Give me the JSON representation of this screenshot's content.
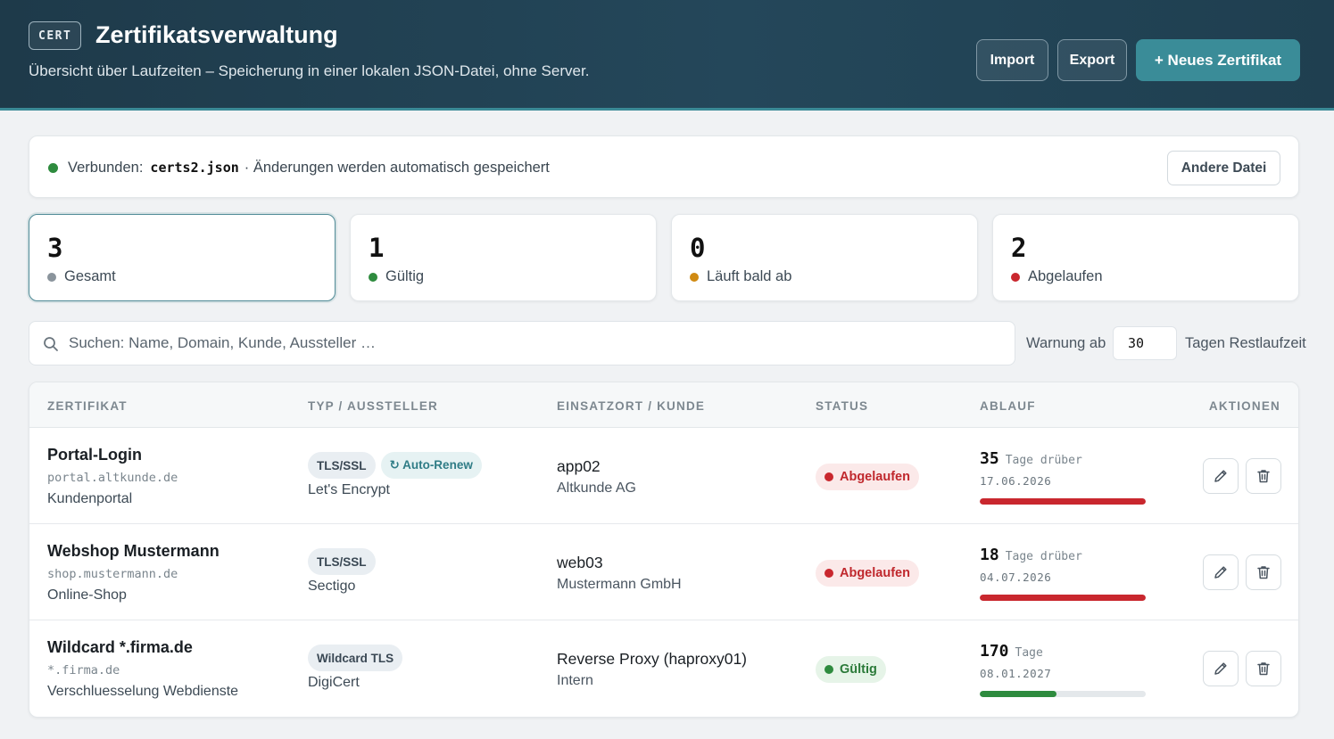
{
  "header": {
    "badge": "CERT",
    "title": "Zertifikatsverwaltung",
    "subtitle": "Übersicht über Laufzeiten – Speicherung in einer lokalen JSON-Datei, ohne Server.",
    "import_label": "Import",
    "export_label": "Export",
    "new_label": "+ Neues Zertifikat"
  },
  "connection": {
    "label": "Verbunden:",
    "file": "certs2.json",
    "note": "· Änderungen werden automatisch gespeichert",
    "other_file_label": "Andere Datei"
  },
  "stats": [
    {
      "value": "3",
      "label": "Gesamt",
      "color": "#8a949c"
    },
    {
      "value": "1",
      "label": "Gültig",
      "color": "#2e8b3e"
    },
    {
      "value": "0",
      "label": "Läuft bald ab",
      "color": "#d08a12"
    },
    {
      "value": "2",
      "label": "Abgelaufen",
      "color": "#c9272e"
    }
  ],
  "search": {
    "placeholder": "Suchen: Name, Domain, Kunde, Aussteller …",
    "warn_label": "Warnung ab",
    "warn_value": "30",
    "warn_suffix": "Tagen Restlaufzeit"
  },
  "table": {
    "headers": [
      "ZERTIFIKAT",
      "TYP / AUSSTELLER",
      "EINSATZORT / KUNDE",
      "STATUS",
      "ABLAUF",
      "AKTIONEN"
    ],
    "rows": [
      {
        "name": "Portal-Login",
        "domain": "portal.altkunde.de",
        "description": "Kundenportal",
        "tags": [
          "TLS/SSL",
          "↻ Auto-Renew"
        ],
        "issuer": "Let's Encrypt",
        "place": "app02",
        "customer": "Altkunde AG",
        "status": "Abgelaufen",
        "status_type": "expired",
        "days": "35",
        "days_unit": "Tage drüber",
        "date": "17.06.2026",
        "progress": 1.0,
        "bar_color": "#c9272e"
      },
      {
        "name": "Webshop Mustermann",
        "domain": "shop.mustermann.de",
        "description": "Online-Shop",
        "tags": [
          "TLS/SSL"
        ],
        "issuer": "Sectigo",
        "place": "web03",
        "customer": "Mustermann GmbH",
        "status": "Abgelaufen",
        "status_type": "expired",
        "days": "18",
        "days_unit": "Tage drüber",
        "date": "04.07.2026",
        "progress": 1.0,
        "bar_color": "#c9272e"
      },
      {
        "name": "Wildcard *.firma.de",
        "domain": "*.firma.de",
        "description": "Verschluesselung Webdienste",
        "tags": [
          "Wildcard TLS"
        ],
        "issuer": "DigiCert",
        "place": "Reverse Proxy (haproxy01)",
        "customer": "Intern",
        "status": "Gültig",
        "status_type": "valid",
        "days": "170",
        "days_unit": "Tage",
        "date": "08.01.2027",
        "progress": 0.46,
        "bar_color": "#2e8b3e"
      }
    ]
  },
  "icons": {
    "search": "search-icon",
    "edit": "pencil-icon",
    "delete": "trash-icon"
  }
}
